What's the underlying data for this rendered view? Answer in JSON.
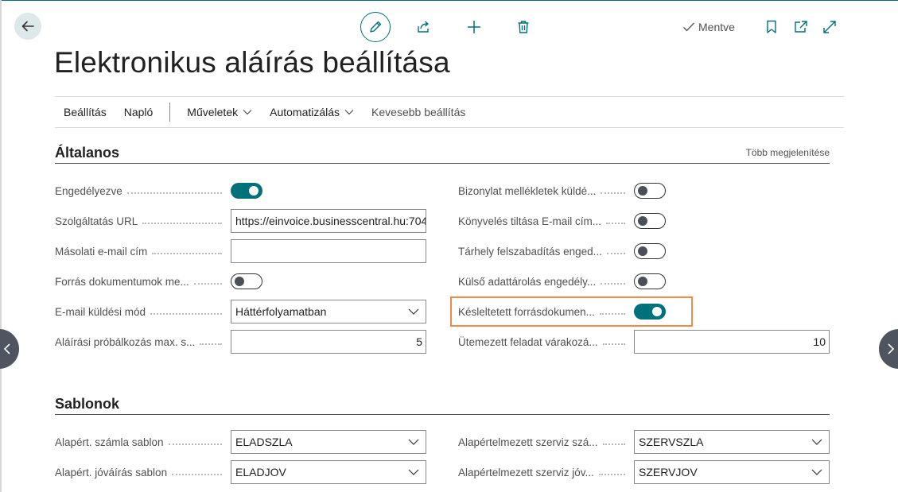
{
  "header": {
    "saved_label": "Mentve",
    "page_title": "Elektronikus aláírás beállítása"
  },
  "actions": {
    "items": [
      {
        "label": "Beállítás"
      },
      {
        "label": "Napló"
      },
      {
        "label": "Műveletek"
      },
      {
        "label": "Automatizálás"
      },
      {
        "label": "Kevesebb beállítás"
      }
    ]
  },
  "general": {
    "title": "Általanos",
    "show_more": "Több megjelenítése",
    "left": [
      {
        "label": "Engedélyezve",
        "type": "toggle",
        "value": true
      },
      {
        "label": "Szolgáltatás URL",
        "type": "text",
        "value": "https://einvoice.businesscentral.hu:704"
      },
      {
        "label": "Másolati e-mail cím",
        "type": "text",
        "value": ""
      },
      {
        "label": "Forrás dokumentumok me...",
        "type": "toggle",
        "value": false
      },
      {
        "label": "E-mail küldési mód",
        "type": "select",
        "value": "Háttérfolyamatban"
      },
      {
        "label": "Aláírási próbálkozás max. s...",
        "type": "number",
        "value": "5"
      }
    ],
    "right": [
      {
        "label": "Bizonylat mellékletek küldé...",
        "type": "toggle",
        "value": false
      },
      {
        "label": "Könyvelés tiltása E-mail cím...",
        "type": "toggle",
        "value": false
      },
      {
        "label": "Tárhely felszabadítás enged...",
        "type": "toggle",
        "value": false
      },
      {
        "label": "Külső adattárolás engedély...",
        "type": "toggle",
        "value": false
      },
      {
        "label": "Késleltetett forrásdokumen...",
        "type": "toggle",
        "value": true
      },
      {
        "label": "Ütemezett feladat várakozá...",
        "type": "number",
        "value": "10"
      }
    ]
  },
  "templates": {
    "title": "Sablonok",
    "left": [
      {
        "label": "Alapért. számla sablon",
        "value": "ELADSZLA"
      },
      {
        "label": "Alapért. jóváírás sablon",
        "value": "ELADJOV"
      }
    ],
    "right": [
      {
        "label": "Alapértelmezett szerviz szá...",
        "value": "SZERVSZLA"
      },
      {
        "label": "Alapértelmezett szerviz jóv...",
        "value": "SZERVJOV"
      }
    ]
  },
  "colors": {
    "accent": "#00707a",
    "highlight": "#f08a4b"
  },
  "icons": [
    "back-arrow-icon",
    "pencil-icon",
    "share-icon",
    "plus-icon",
    "trash-icon",
    "checkmark-icon",
    "bookmark-icon",
    "open-in-new-icon",
    "expand-icon",
    "chevron-down-icon",
    "chevron-left-icon",
    "chevron-right-icon"
  ]
}
